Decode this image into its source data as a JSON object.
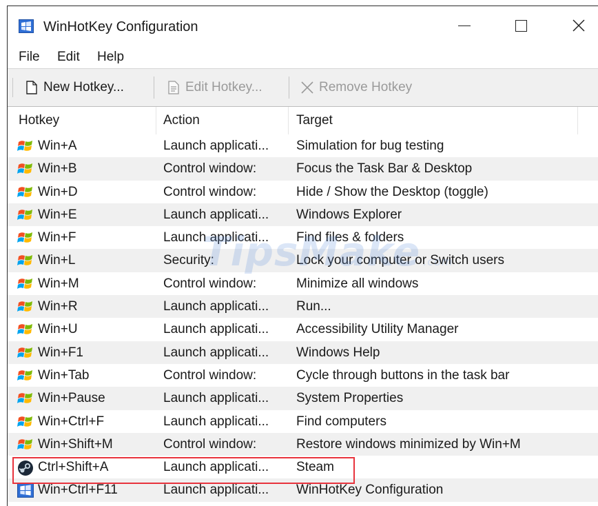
{
  "window": {
    "title": "WinHotKey Configuration"
  },
  "menu": {
    "file": "File",
    "edit": "Edit",
    "help": "Help"
  },
  "toolbar": {
    "new_hotkey": "New Hotkey...",
    "edit_hotkey": "Edit Hotkey...",
    "remove_hotkey": "Remove Hotkey"
  },
  "columns": {
    "hotkey": "Hotkey",
    "action": "Action",
    "target": "Target"
  },
  "rows": [
    {
      "hotkey": "Win+A",
      "action": "Launch applicati...",
      "target": "Simulation for bug testing",
      "icon": "windows-flag-icon"
    },
    {
      "hotkey": "Win+B",
      "action": "Control window:",
      "target": "Focus the Task Bar & Desktop",
      "icon": "windows-flag-icon"
    },
    {
      "hotkey": "Win+D",
      "action": "Control window:",
      "target": "Hide / Show the Desktop (toggle)",
      "icon": "windows-flag-icon"
    },
    {
      "hotkey": "Win+E",
      "action": "Launch applicati...",
      "target": "Windows Explorer",
      "icon": "windows-flag-icon"
    },
    {
      "hotkey": "Win+F",
      "action": "Launch applicati...",
      "target": "Find files & folders",
      "icon": "windows-flag-icon"
    },
    {
      "hotkey": "Win+L",
      "action": "Security:",
      "target": "Lock your computer or Switch users",
      "icon": "windows-flag-icon"
    },
    {
      "hotkey": "Win+M",
      "action": "Control window:",
      "target": "Minimize all windows",
      "icon": "windows-flag-icon"
    },
    {
      "hotkey": "Win+R",
      "action": "Launch applicati...",
      "target": "Run...",
      "icon": "windows-flag-icon"
    },
    {
      "hotkey": "Win+U",
      "action": "Launch applicati...",
      "target": "Accessibility Utility Manager",
      "icon": "windows-flag-icon"
    },
    {
      "hotkey": "Win+F1",
      "action": "Launch applicati...",
      "target": "Windows Help",
      "icon": "windows-flag-icon"
    },
    {
      "hotkey": "Win+Tab",
      "action": "Control window:",
      "target": "Cycle through buttons in the task bar",
      "icon": "windows-flag-icon"
    },
    {
      "hotkey": "Win+Pause",
      "action": "Launch applicati...",
      "target": "System Properties",
      "icon": "windows-flag-icon"
    },
    {
      "hotkey": "Win+Ctrl+F",
      "action": "Launch applicati...",
      "target": "Find computers",
      "icon": "windows-flag-icon"
    },
    {
      "hotkey": "Win+Shift+M",
      "action": "Control window:",
      "target": "Restore windows minimized by Win+M",
      "icon": "windows-flag-icon"
    },
    {
      "hotkey": "Ctrl+Shift+A",
      "action": "Launch applicati...",
      "target": "Steam",
      "icon": "steam-icon"
    },
    {
      "hotkey": "Win+Ctrl+F11",
      "action": "Launch applicati...",
      "target": "WinHotKey Configuration",
      "icon": "winhotkey-icon"
    }
  ],
  "watermark": {
    "text": "TipsMake",
    "suffix": ".com"
  },
  "colors": {
    "highlight": "#e8323c",
    "alt_row": "#f0f0f0",
    "toolbar_bg": "#f0f0f0"
  }
}
